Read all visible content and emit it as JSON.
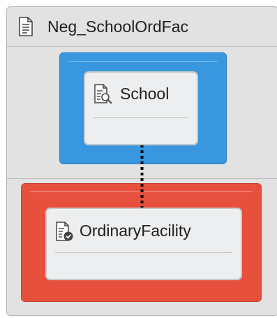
{
  "diagram": {
    "title": "Neg_SchoolOrdFac",
    "icon": "document-icon",
    "colors": {
      "panel_background": "#e2e2e2",
      "upper_container": "#3897df",
      "lower_container": "#e8503e",
      "card_background": "#eceeef",
      "connector": "#000000"
    },
    "nodes": [
      {
        "label": "School",
        "icon": "search-document-icon",
        "container_color": "blue"
      },
      {
        "label": "OrdinaryFacility",
        "icon": "verified-document-icon",
        "container_color": "red"
      }
    ],
    "connector": {
      "style": "dotted",
      "from": "School",
      "to": "OrdinaryFacility"
    }
  }
}
